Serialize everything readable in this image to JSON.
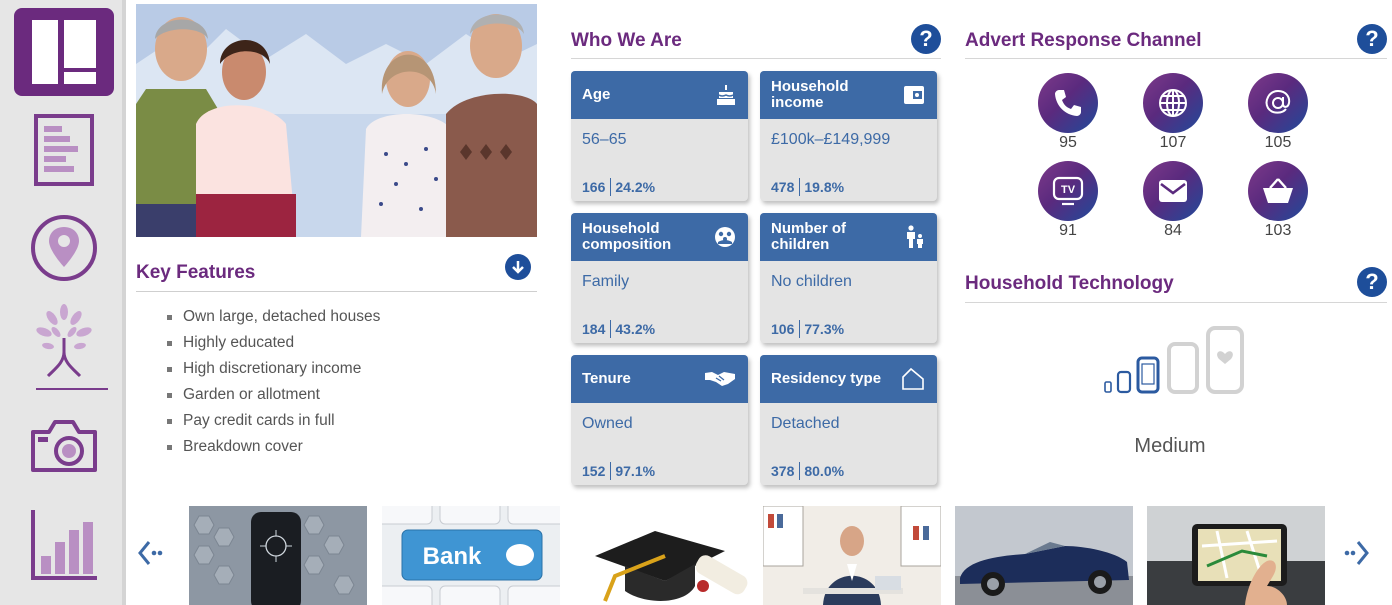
{
  "colors": {
    "brand_purple": "#6b2a7e",
    "card_blue": "#3d6aa6",
    "help_blue": "#1e4e9a",
    "sidebar_bg": "#e6e6e6"
  },
  "sidebar": {
    "items": [
      {
        "icon": "dashboard-icon",
        "active": true
      },
      {
        "icon": "report-icon"
      },
      {
        "icon": "location-pin-icon"
      },
      {
        "icon": "tree-icon"
      },
      {
        "icon": "camera-icon"
      },
      {
        "icon": "bar-chart-icon"
      }
    ]
  },
  "key_features": {
    "title": "Key Features",
    "items": [
      "Own large, detached houses",
      "Highly educated",
      "High discretionary income",
      "Garden or allotment",
      "Pay credit cards in full",
      "Breakdown cover"
    ]
  },
  "who_we_are": {
    "title": "Who We Are",
    "help": "?",
    "cards": [
      {
        "title_1": "Age",
        "title_2": "",
        "icon": "birthday-cake-icon",
        "value": "56–65",
        "index": "166",
        "percent": "24.2%"
      },
      {
        "title_1": "Household",
        "title_2": "income",
        "icon": "wallet-icon",
        "value": "£100k–£149,999",
        "index": "478",
        "percent": "19.8%"
      },
      {
        "title_1": "Household",
        "title_2": "composition",
        "icon": "family-circle-icon",
        "value": "Family",
        "index": "184",
        "percent": "43.2%"
      },
      {
        "title_1": "Number of",
        "title_2": "children",
        "icon": "parent-child-icon",
        "value": "No children",
        "index": "106",
        "percent": "77.3%"
      },
      {
        "title_1": "Tenure",
        "title_2": "",
        "icon": "handshake-icon",
        "value": "Owned",
        "index": "152",
        "percent": "97.1%"
      },
      {
        "title_1": "Residency type",
        "title_2": "",
        "icon": "house-outline-icon",
        "value": "Detached",
        "index": "378",
        "percent": "80.0%"
      }
    ]
  },
  "advert_response": {
    "title": "Advert Response Channel",
    "help": "?",
    "channels": [
      {
        "icon": "phone-icon",
        "value": "95"
      },
      {
        "icon": "globe-icon",
        "value": "107"
      },
      {
        "icon": "email-at-icon",
        "value": "105"
      },
      {
        "icon": "tv-icon",
        "value": "91"
      },
      {
        "icon": "envelope-icon",
        "value": "84"
      },
      {
        "icon": "shopping-basket-icon",
        "value": "103"
      }
    ]
  },
  "household_technology": {
    "title": "Household Technology",
    "help": "?",
    "level": "Medium",
    "level_value": 3,
    "level_max": 5
  },
  "carousel": {
    "thumbnails": [
      {
        "subject": "smartphone-on-hexagon-pattern"
      },
      {
        "subject": "keyboard-bank-key",
        "text": "Bank"
      },
      {
        "subject": "graduation-cap-and-diploma"
      },
      {
        "subject": "businessman-at-desk"
      },
      {
        "subject": "blue-convertible-car"
      },
      {
        "subject": "sat-nav-device"
      }
    ]
  }
}
